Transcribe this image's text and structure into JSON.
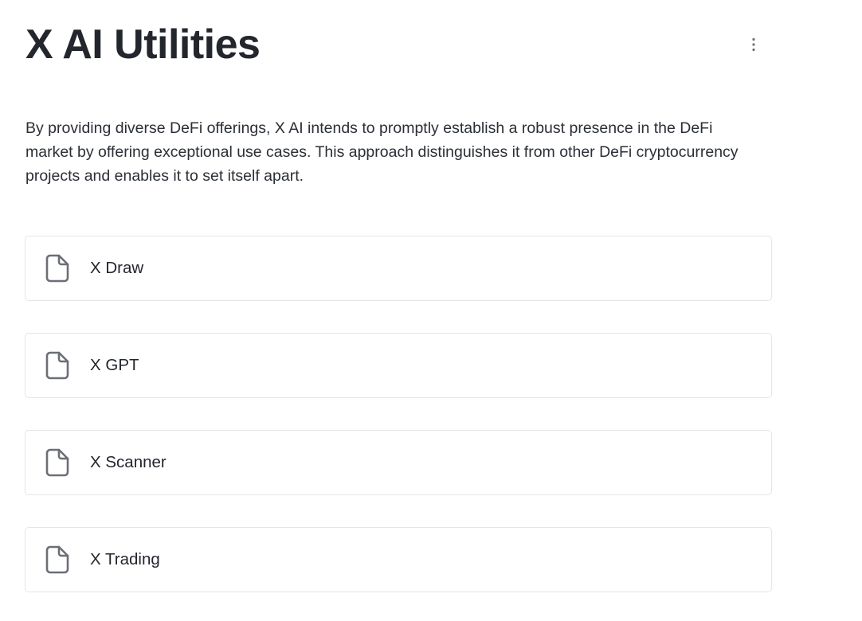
{
  "page": {
    "title": "X AI Utilities",
    "description": "By providing diverse DeFi offerings, X AI intends to promptly establish a robust presence in the DeFi market by offering exceptional use cases. This approach distinguishes it from other DeFi cryptocurrency projects and enables it to set itself apart."
  },
  "menu": {
    "icon": "more-vertical-icon"
  },
  "cards": [
    {
      "label": "X Draw",
      "icon": "document-icon"
    },
    {
      "label": "X GPT",
      "icon": "document-icon"
    },
    {
      "label": "X Scanner",
      "icon": "document-icon"
    },
    {
      "label": "X Trading",
      "icon": "document-icon"
    }
  ],
  "colors": {
    "text": "#23262d",
    "border": "#e3e5e8",
    "icon": "#6b6f76"
  }
}
